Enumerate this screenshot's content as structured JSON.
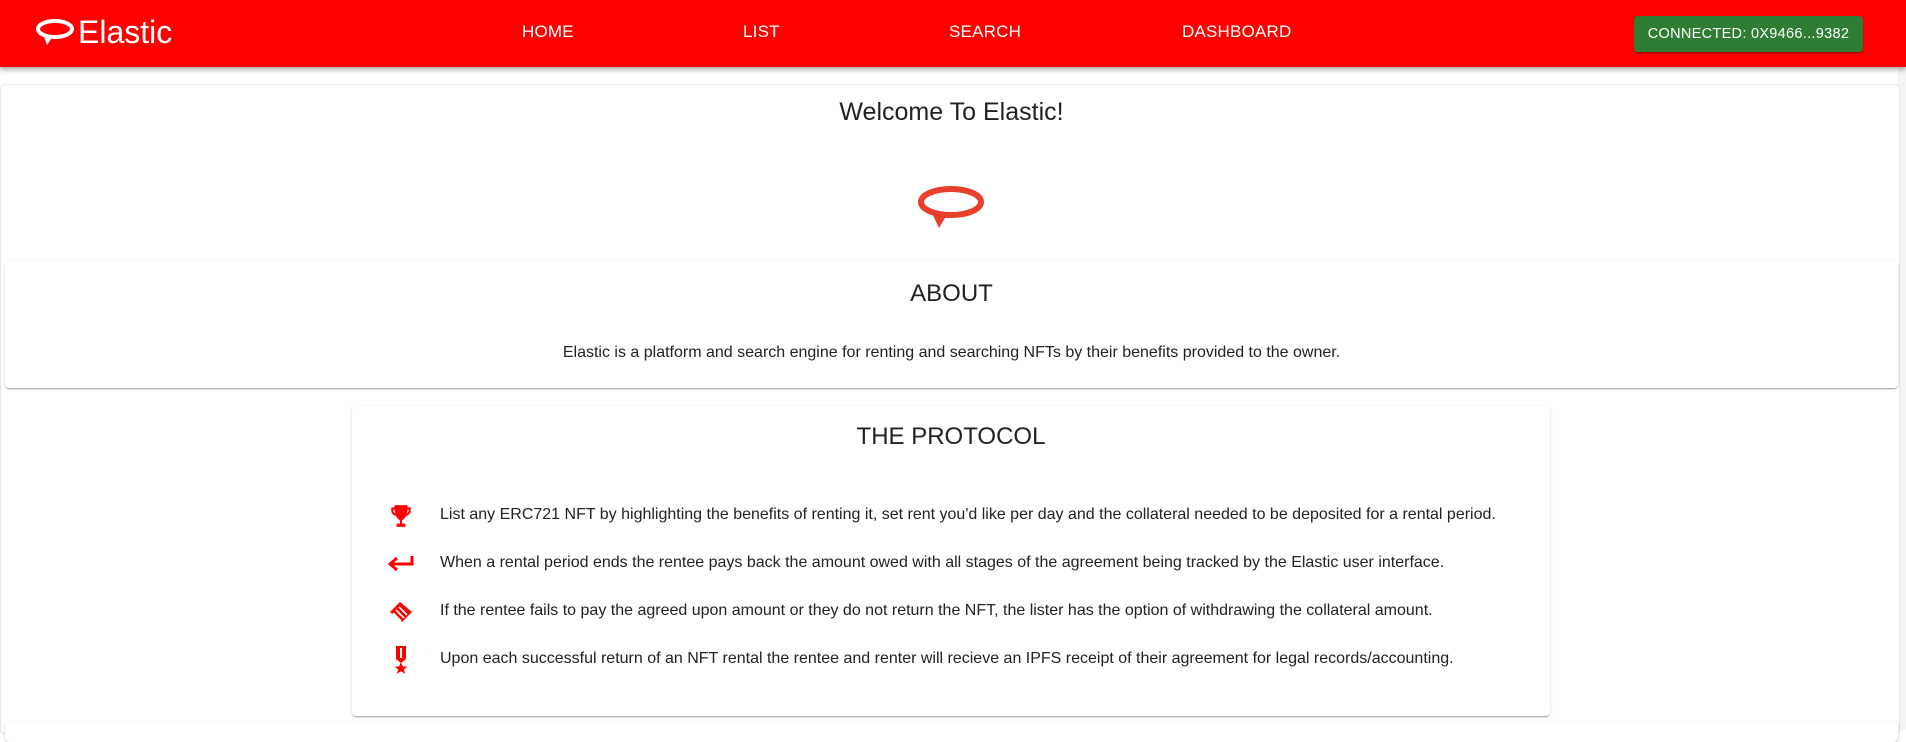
{
  "app": {
    "brand_name": "Elastic",
    "brand_color": "#ff0000",
    "logo_icon": "rotate-arrow-icon"
  },
  "nav": {
    "items": [
      {
        "label": "HOME"
      },
      {
        "label": "LIST"
      },
      {
        "label": "SEARCH"
      },
      {
        "label": "DASHBOARD"
      }
    ],
    "connect_label": "CONNECTED: 0X9466...9382",
    "connect_color": "#2e7d32"
  },
  "welcome": {
    "title": "Welcome To Elastic!",
    "logo_color": "#e8402a"
  },
  "about": {
    "title": "ABOUT",
    "text": "Elastic is a platform and search engine for renting and searching NFTs by their benefits provided to the owner."
  },
  "protocol": {
    "title": "THE PROTOCOL",
    "icon_color": "#ff0000",
    "items": [
      {
        "icon": "trophy-icon",
        "text": "List any ERC721 NFT by highlighting the benefits of renting it, set rent you'd like per day and the collateral needed to be deposited for a rental period."
      },
      {
        "icon": "keyboard-return-icon",
        "text": "When a rental period ends the rentee pays back the amount owed with all stages of the agreement being tracked by the Elastic user interface."
      },
      {
        "icon": "handshake-icon",
        "text": "If the rentee fails to pay the agreed upon amount or they do not return the NFT, the lister has the option of withdrawing the collateral amount."
      },
      {
        "icon": "medal-icon",
        "text": "Upon each successful return of an NFT rental the rentee and renter will recieve an IPFS receipt of their agreement for legal records/accounting."
      }
    ]
  }
}
